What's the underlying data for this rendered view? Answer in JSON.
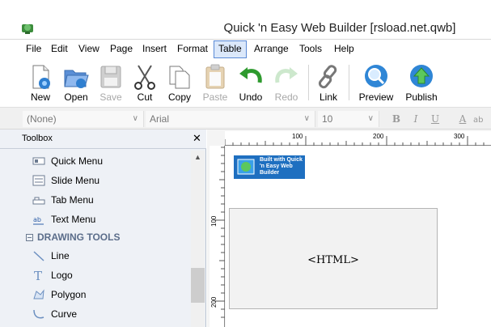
{
  "window": {
    "title": "Quick 'n Easy Web Builder [rsload.net.qwb]"
  },
  "menu": [
    {
      "label": "File"
    },
    {
      "label": "Edit"
    },
    {
      "label": "View"
    },
    {
      "label": "Page"
    },
    {
      "label": "Insert"
    },
    {
      "label": "Format"
    },
    {
      "label": "Table"
    },
    {
      "label": "Arrange"
    },
    {
      "label": "Tools"
    },
    {
      "label": "Help"
    }
  ],
  "menu_active": "Table",
  "toolbar": {
    "new": "New",
    "open": "Open",
    "save": "Save",
    "cut": "Cut",
    "copy": "Copy",
    "paste": "Paste",
    "undo": "Undo",
    "redo": "Redo",
    "link": "Link",
    "preview": "Preview",
    "publish": "Publish"
  },
  "format": {
    "style": "(None)",
    "font": "Arial",
    "size": "10",
    "bold": "B",
    "italic": "I",
    "underline": "U",
    "color": "A"
  },
  "toolbox": {
    "title": "Toolbox",
    "items": [
      {
        "label": "Quick Menu"
      },
      {
        "label": "Slide Menu"
      },
      {
        "label": "Tab Menu"
      },
      {
        "label": "Text Menu"
      }
    ],
    "section": "DRAWING TOOLS",
    "drawing": [
      {
        "label": "Line"
      },
      {
        "label": "Logo"
      },
      {
        "label": "Polygon"
      },
      {
        "label": "Curve"
      }
    ]
  },
  "ruler": {
    "h": [
      "100",
      "200",
      "300"
    ],
    "v": [
      "100",
      "200"
    ]
  },
  "canvas": {
    "badge": "Built with Quick 'n Easy Web Builder",
    "html_placeholder": "<HTML>"
  },
  "colors": {
    "accent": "#1e6fc0",
    "menu_highlight": "#dbe8fa"
  }
}
